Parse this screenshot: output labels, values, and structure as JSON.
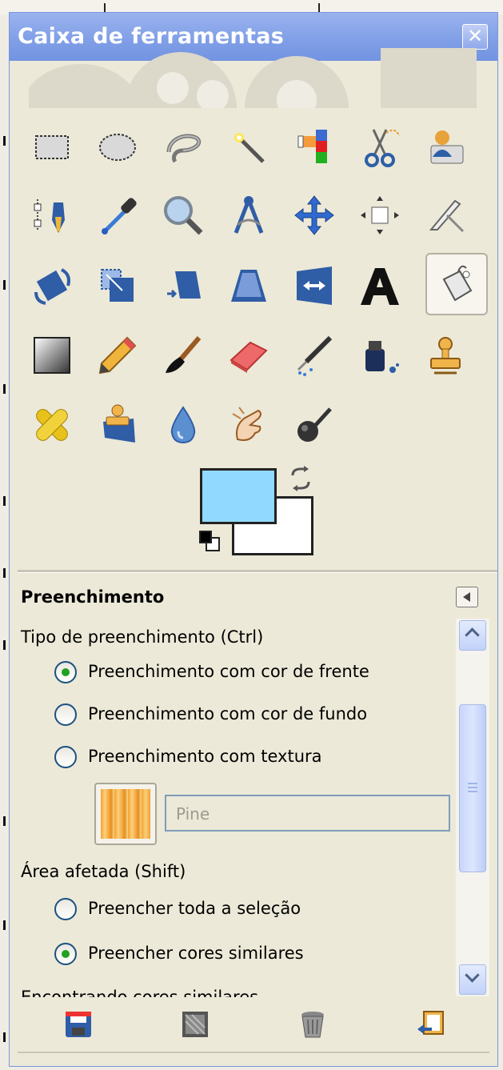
{
  "window": {
    "title": "Caixa de ferramentas",
    "close_glyph": "✕"
  },
  "tools": [
    {
      "name": "rect-select-tool-icon"
    },
    {
      "name": "ellipse-select-tool-icon"
    },
    {
      "name": "free-select-tool-icon"
    },
    {
      "name": "fuzzy-select-tool-icon"
    },
    {
      "name": "select-by-color-tool-icon"
    },
    {
      "name": "scissors-select-tool-icon"
    },
    {
      "name": "foreground-select-tool-icon"
    },
    {
      "name": "paths-tool-icon"
    },
    {
      "name": "color-picker-tool-icon"
    },
    {
      "name": "zoom-tool-icon"
    },
    {
      "name": "measure-tool-icon"
    },
    {
      "name": "move-tool-icon"
    },
    {
      "name": "align-tool-icon"
    },
    {
      "name": "crop-tool-icon"
    },
    {
      "name": "rotate-tool-icon"
    },
    {
      "name": "scale-tool-icon"
    },
    {
      "name": "shear-tool-icon"
    },
    {
      "name": "perspective-tool-icon"
    },
    {
      "name": "flip-tool-icon"
    },
    {
      "name": "text-tool-icon"
    },
    {
      "name": "bucket-fill-tool-icon",
      "active": true
    },
    {
      "name": "blend-tool-icon"
    },
    {
      "name": "pencil-tool-icon"
    },
    {
      "name": "paintbrush-tool-icon"
    },
    {
      "name": "eraser-tool-icon"
    },
    {
      "name": "airbrush-tool-icon"
    },
    {
      "name": "ink-tool-icon"
    },
    {
      "name": "clone-tool-icon"
    },
    {
      "name": "heal-tool-icon"
    },
    {
      "name": "perspective-clone-tool-icon"
    },
    {
      "name": "blur-sharpen-tool-icon"
    },
    {
      "name": "smudge-tool-icon"
    },
    {
      "name": "dodge-burn-tool-icon"
    }
  ],
  "colors": {
    "foreground": "#91d9ff",
    "background": "#ffffff"
  },
  "options": {
    "title": "Preenchimento",
    "fill_type_label": "Tipo de preenchimento  (Ctrl)",
    "fill_types": [
      {
        "label": "Preenchimento com cor de frente",
        "selected": true
      },
      {
        "label": "Preenchimento com cor de fundo",
        "selected": false
      },
      {
        "label": "Preenchimento com textura",
        "selected": false
      }
    ],
    "pattern_name": "Pine",
    "affected_area_label": "Área afetada  (Shift)",
    "affected_areas": [
      {
        "label": "Preencher toda a seleção",
        "selected": false
      },
      {
        "label": "Preencher cores similares",
        "selected": true
      }
    ],
    "cut_off_label": "Encontrando cores similares"
  },
  "bottom_buttons": [
    {
      "name": "save-options-icon"
    },
    {
      "name": "restore-options-icon"
    },
    {
      "name": "delete-options-icon"
    },
    {
      "name": "reset-options-icon"
    }
  ]
}
